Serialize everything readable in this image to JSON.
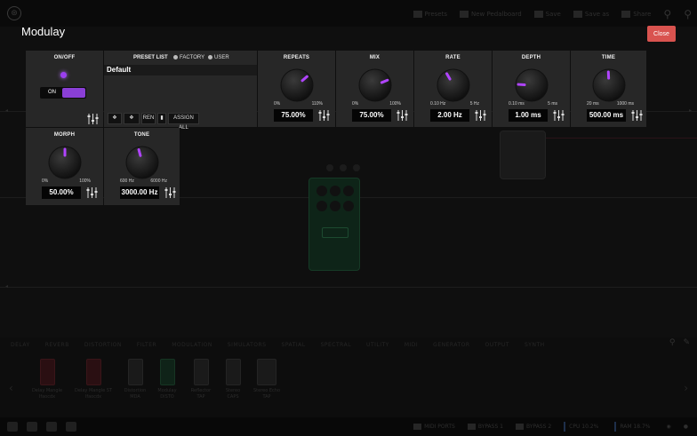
{
  "background": {
    "nav": [
      "Presets",
      "New Pedalboard",
      "Save",
      "Save as",
      "Share"
    ],
    "tabs": [
      "DELAY",
      "REVERB",
      "DISTORTION",
      "FILTER",
      "MODULATION",
      "SIMULATORS",
      "SPATIAL",
      "SPECTRAL",
      "UTILITY",
      "MIDI",
      "GENERATOR",
      "OUTPUT",
      "SYNTH"
    ],
    "active_tab": "DELAY",
    "shelf": [
      {
        "name": "Delay Mangle",
        "sub": "Ifaocdx"
      },
      {
        "name": "Delay Mangle ST",
        "sub": "Ifaocdx"
      },
      {
        "name": "Distortion",
        "sub": "MDA"
      },
      {
        "name": "Modulay",
        "sub": "DISTO"
      },
      {
        "name": "Reflector",
        "sub": "TAP"
      },
      {
        "name": "Stereo",
        "sub": "CAPS"
      },
      {
        "name": "Stereo Echo",
        "sub": "TAP"
      }
    ],
    "status": {
      "midi": "MIDI PORTS",
      "bypass1": "BYPASS 1",
      "bypass2": "BYPASS 2",
      "cpu": "CPU 10.2%",
      "ram": "RAM 18.7%"
    }
  },
  "title": "Modulay",
  "close_label": "Close",
  "onoff": {
    "header": "ON/OFF",
    "state_label": "ON",
    "led_color": "#9b3ff0"
  },
  "preset_list": {
    "header": "PRESET LIST",
    "factory_label": "FACTORY",
    "user_label": "USER",
    "current": "Default",
    "ren_label": "REN",
    "assign_all_label": "ASSIGN ALL"
  },
  "params": [
    {
      "id": "repeats",
      "header": "REPEATS",
      "min": "0%",
      "max": "110%",
      "value": "75.00%",
      "level": 0.682
    },
    {
      "id": "mix",
      "header": "MIX",
      "min": "0%",
      "max": "100%",
      "value": "75.00%",
      "level": 0.75
    },
    {
      "id": "rate",
      "header": "RATE",
      "min": "0.10 Hz",
      "max": "5 Hz",
      "value": "2.00 Hz",
      "level": 0.39
    },
    {
      "id": "depth",
      "header": "DEPTH",
      "min": "0.10 ms",
      "max": "5 ms",
      "value": "1.00 ms",
      "level": 0.18
    },
    {
      "id": "time",
      "header": "TIME",
      "min": "20 ms",
      "max": "1000 ms",
      "value": "500.00 ms",
      "level": 0.49
    },
    {
      "id": "morph",
      "header": "MORPH",
      "min": "0%",
      "max": "100%",
      "value": "50.00%",
      "level": 0.5
    },
    {
      "id": "tone",
      "header": "TONE",
      "min": "600 Hz",
      "max": "6000 Hz",
      "value": "3000.00 Hz",
      "level": 0.444
    }
  ],
  "accent_color": "#b044ff",
  "close_color": "#d9534f"
}
